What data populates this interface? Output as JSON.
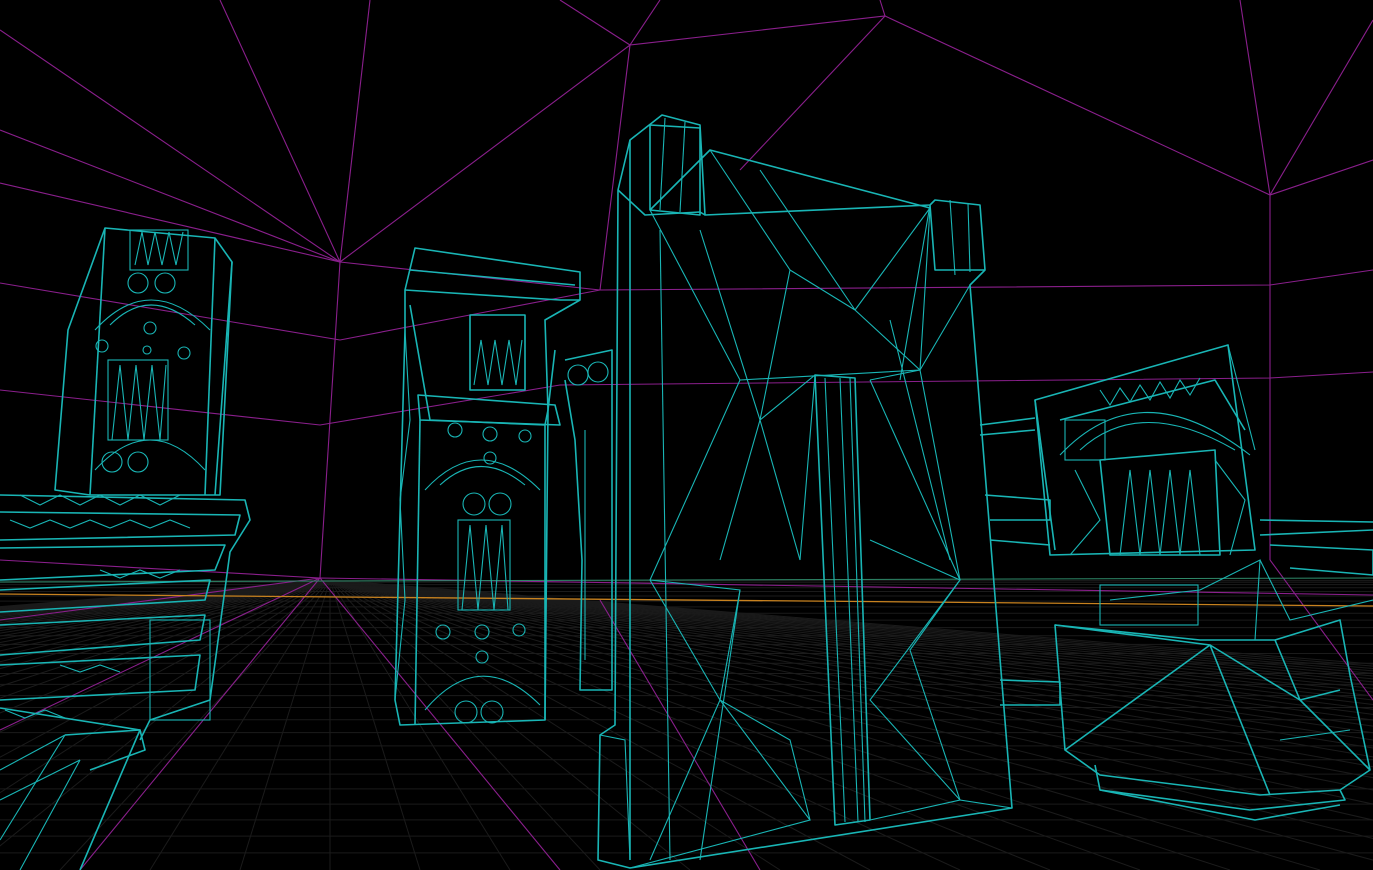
{
  "viewport": {
    "mode": "wireframe",
    "colors": {
      "background": "#000000",
      "mesh_wire": "#19b5b5",
      "sky_wire": "#8a1f8c",
      "floor_grid": "#1b1b1b",
      "axis_x": "#c8821f",
      "axis_y": "#2f8a6a",
      "toolbar_button": "#3a3a3a",
      "toolbar_active": "#1a56c8"
    }
  },
  "toolbar": {
    "left_buttons": [
      "view-button-1",
      "view-button-2",
      "view-button-3",
      "view-button-4"
    ],
    "right_buttons": [
      "tool-button-1",
      "tool-button-2",
      "tool-button-3",
      "tool-button-4",
      "tool-button-5",
      "tool-button-6",
      "tool-button-7"
    ],
    "active_index": 1
  },
  "objects": [
    {
      "name": "left-carved-pillar",
      "icon": "pillar-mesh"
    },
    {
      "name": "left-stair-ruin",
      "icon": "stairs-mesh"
    },
    {
      "name": "center-left-carved-pillar",
      "icon": "pillar-mesh"
    },
    {
      "name": "center-wall-slab",
      "icon": "wall-mesh"
    },
    {
      "name": "right-arch-ruin",
      "icon": "arch-mesh"
    },
    {
      "name": "right-fallen-block",
      "icon": "block-mesh"
    }
  ]
}
